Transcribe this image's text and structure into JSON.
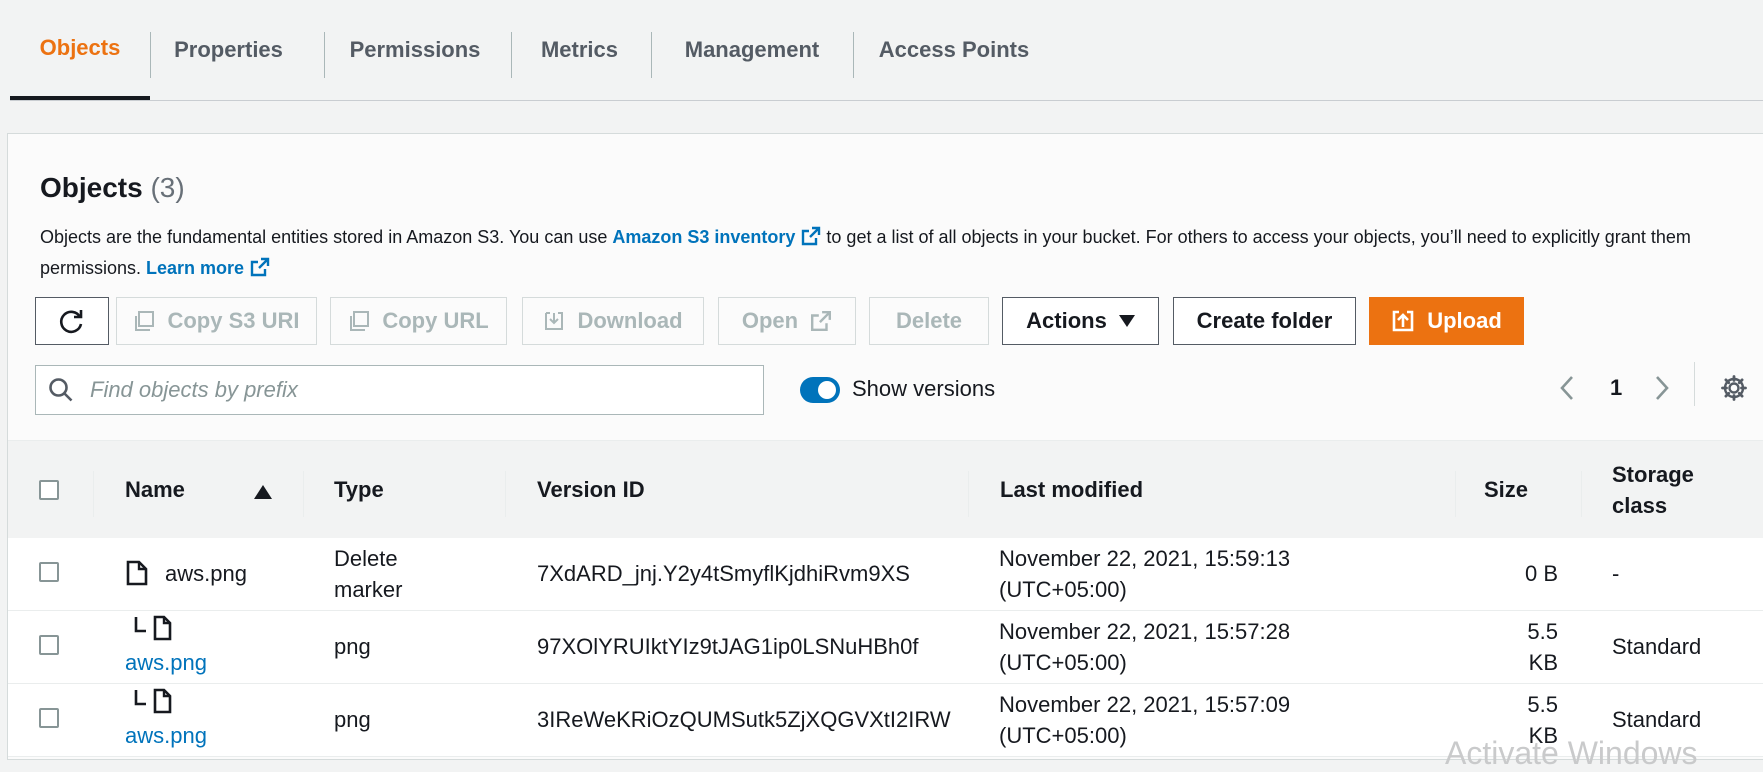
{
  "tabs": [
    {
      "label": "Objects",
      "active": true
    },
    {
      "label": "Properties"
    },
    {
      "label": "Permissions"
    },
    {
      "label": "Metrics"
    },
    {
      "label": "Management"
    },
    {
      "label": "Access Points"
    }
  ],
  "panel": {
    "title": "Objects",
    "count": "(3)",
    "description": {
      "part1": "Objects are the fundamental entities stored in Amazon S3. You can use ",
      "link1": "Amazon S3 inventory",
      "part2": " to get a list of all objects in your bucket. For others to access your objects, you’ll need to explicitly grant them permissions. ",
      "link2": "Learn more"
    }
  },
  "toolbar": {
    "refresh_icon": "refresh-icon",
    "copy_s3_uri": "Copy S3 URI",
    "copy_url": "Copy URL",
    "download": "Download",
    "open": "Open",
    "delete": "Delete",
    "actions": "Actions",
    "create_folder": "Create folder",
    "upload": "Upload"
  },
  "search": {
    "placeholder": "Find objects by prefix",
    "value": ""
  },
  "show_versions": {
    "label": "Show versions",
    "on": true
  },
  "pagination": {
    "page": "1"
  },
  "table": {
    "headers": {
      "name": "Name",
      "type": "Type",
      "version_id": "Version ID",
      "last_modified": "Last modified",
      "size": "Size",
      "storage_class_1": "Storage",
      "storage_class_2": "class"
    },
    "rows": [
      {
        "name": "aws.png",
        "type1": "Delete",
        "type2": "marker",
        "version_id": "7XdARD_jnj.Y2y4tSmyflKjdhiRvm9XS",
        "modified1": "November 22, 2021, 15:59:13",
        "modified2": "(UTC+05:00)",
        "size1": "0 B",
        "size2": "",
        "storage": "-"
      },
      {
        "name": "aws.png",
        "type1": "png",
        "type2": "",
        "version_id": "97XOlYRUIktYIz9tJAG1ip0LSNuHBh0f",
        "modified1": "November 22, 2021, 15:57:28",
        "modified2": "(UTC+05:00)",
        "size1": "5.5",
        "size2": "KB",
        "storage": "Standard"
      },
      {
        "name": "aws.png",
        "type1": "png",
        "type2": "",
        "version_id": "3IReWeKRiOzQUMSutk5ZjXQGVXtI2IRW",
        "modified1": "November 22, 2021, 15:57:09",
        "modified2": "(UTC+05:00)",
        "size1": "5.5",
        "size2": "KB",
        "storage": "Standard"
      }
    ]
  },
  "watermark": "Activate Windows",
  "colors": {
    "accent": "#ec7211",
    "link": "#0073bb",
    "text": "#16191f",
    "disabled": "#aab7b8"
  }
}
